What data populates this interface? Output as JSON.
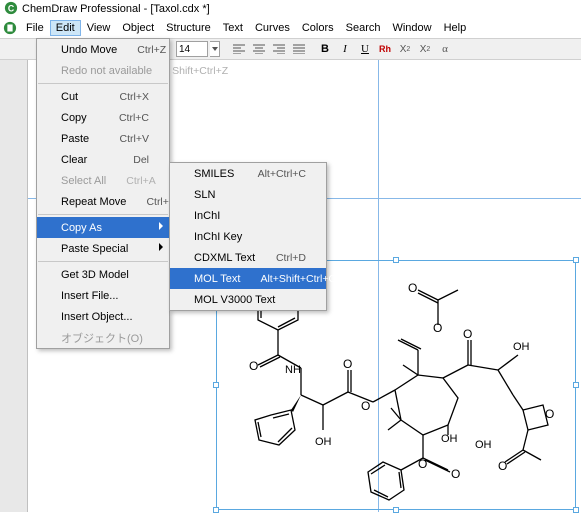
{
  "title": "ChemDraw Professional - [Taxol.cdx *]",
  "menubar": [
    "File",
    "Edit",
    "View",
    "Object",
    "Structure",
    "Text",
    "Curves",
    "Colors",
    "Search",
    "Window",
    "Help"
  ],
  "toolbar": {
    "fontsize": "14"
  },
  "edit_menu": {
    "undo": {
      "label": "Undo Move",
      "shortcut": "Ctrl+Z"
    },
    "redo": {
      "label": "Redo not available",
      "shortcut": "Shift+Ctrl+Z"
    },
    "cut": {
      "label": "Cut",
      "shortcut": "Ctrl+X"
    },
    "copy": {
      "label": "Copy",
      "shortcut": "Ctrl+C"
    },
    "paste": {
      "label": "Paste",
      "shortcut": "Ctrl+V"
    },
    "clear": {
      "label": "Clear",
      "shortcut": "Del"
    },
    "selectall": {
      "label": "Select All",
      "shortcut": "Ctrl+A"
    },
    "repeat": {
      "label": "Repeat Move",
      "shortcut": "Ctrl+Y"
    },
    "copyas": {
      "label": "Copy As"
    },
    "pastespec": {
      "label": "Paste Special"
    },
    "get3d": {
      "label": "Get 3D Model"
    },
    "insfile": {
      "label": "Insert File..."
    },
    "insobj": {
      "label": "Insert Object..."
    },
    "objekt": {
      "label": "オブジェクト(O)"
    }
  },
  "copyas_menu": {
    "smiles": {
      "label": "SMILES",
      "shortcut": "Alt+Ctrl+C"
    },
    "sln": {
      "label": "SLN",
      "shortcut": ""
    },
    "inchi": {
      "label": "InChI",
      "shortcut": ""
    },
    "inchikey": {
      "label": "InChI Key",
      "shortcut": ""
    },
    "cdxml": {
      "label": "CDXML Text",
      "shortcut": "Ctrl+D"
    },
    "mol": {
      "label": "MOL Text",
      "shortcut": "Alt+Shift+Ctrl+O"
    },
    "mol3000": {
      "label": "MOL V3000 Text",
      "shortcut": ""
    }
  }
}
